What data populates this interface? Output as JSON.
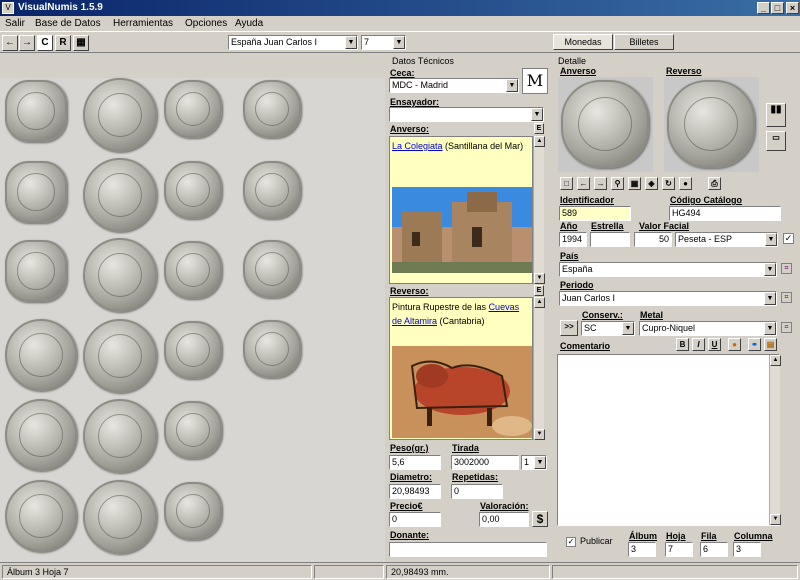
{
  "window": {
    "title": "VisualNumis 1.5.9",
    "min": "_",
    "max": "□",
    "close": "×"
  },
  "menu": [
    "Salir",
    "Base de Datos",
    "Herramientas",
    "Opciones",
    "Ayuda"
  ],
  "toolbar": {
    "back": "←",
    "fwd": "→",
    "c": "C",
    "r": "R",
    "collection": "España Juan Carlos I",
    "page": "7"
  },
  "tabs": {
    "monedas": "Monedas",
    "billetes": "Billetes"
  },
  "tech": {
    "group": "Datos Técnicos",
    "ceca_label": "Ceca:",
    "ceca": "MDC - Madrid",
    "mint_mark": "M",
    "ensayador_label": "Ensayador:",
    "ensayador": "",
    "anverso_label": "Anverso:",
    "anverso_link": "La Colegiata",
    "anverso_rest": " (Santillana del Mar)",
    "reverso_label": "Reverso:",
    "reverso_text": "Pintura Rupestre de las ",
    "reverso_link": "Cuevas de Altamira",
    "reverso_rest": " (Cantabria)",
    "peso_label": "Peso(gr.)",
    "peso": "5,6",
    "tirada_label": "Tirada",
    "tirada": "3002000",
    "tirada_mult": "1",
    "diametro_label": "Diametro:",
    "diametro": "20,98493",
    "repetidas_label": "Repetidas:",
    "repetidas": "0",
    "precio_label": "Precio€",
    "precio": "0",
    "valoracion_label": "Valoración:",
    "valoracion": "0,00",
    "dollar": "$",
    "donante_label": "Donante:",
    "donante": "",
    "e": "E"
  },
  "detail": {
    "group": "Detalle",
    "anverso_label": "Anverso",
    "reverso_label": "Reverso",
    "identificador_label": "Identificador",
    "identificador": "589",
    "codigo_label": "Código Catálogo",
    "codigo": "HG494",
    "ano_label": "Año",
    "ano": "1994",
    "estrella_label": "Estrella",
    "estrella": "",
    "valor_label": "Valor Facial",
    "valor": "50",
    "moneda": "Peseta - ESP",
    "pais_label": "País",
    "pais": "España",
    "periodo_label": "Periodo",
    "periodo": "Juan Carlos I",
    "conserv_label": "Conserv.:",
    "conserv": "SC",
    "metal_label": "Metal",
    "metal": "Cupro-Niquel",
    "comentario_label": "Comentario",
    "comentario": "",
    "publicar": "Publicar",
    "album_label": "Álbum",
    "album": "3",
    "hoja_label": "Hoja",
    "hoja": "7",
    "fila_label": "Fila",
    "fila": "6",
    "columna_label": "Columna",
    "columna": "3",
    "bold": "B",
    "italic": "I",
    "underline": "U",
    "expand": ">>"
  },
  "status": {
    "left": "Álbum 3 Hoja 7",
    "mid": "",
    "value": "20,98493 mm."
  }
}
